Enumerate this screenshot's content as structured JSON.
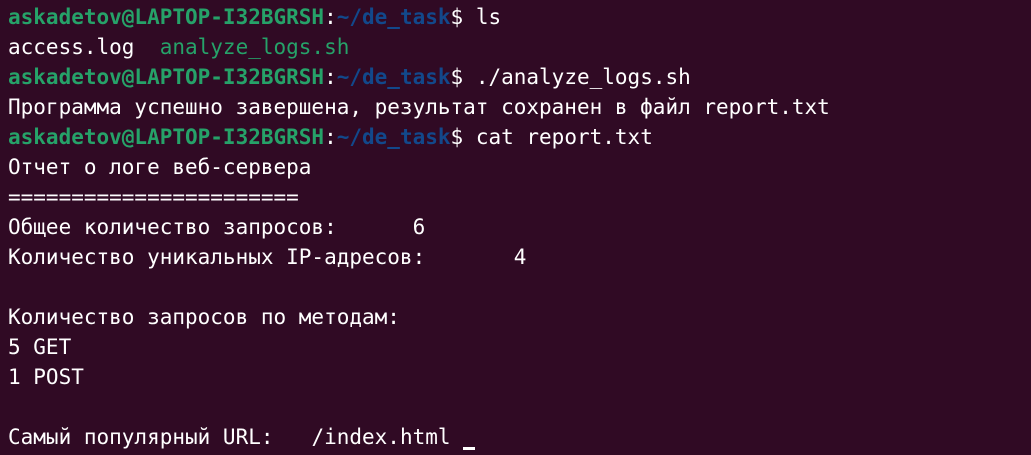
{
  "prompt": {
    "user_host": "askadetov@LAPTOP-I32BGRSH",
    "sep": ":",
    "path": "~/de_task",
    "symbol": "$ "
  },
  "commands": {
    "ls": "ls",
    "run": "./analyze_logs.sh",
    "cat": "cat report.txt"
  },
  "ls_output": {
    "file1": "access.log  ",
    "file2": "analyze_logs.sh"
  },
  "run_output": "Программа успешно завершена, результат сохранен в файл report.txt",
  "report": {
    "title": "Отчет о логе веб-сервера",
    "separator": "=======================",
    "total_label": "Общее количество запросов:",
    "total_gap": "      ",
    "total_value": "6",
    "unique_label": "Количество уникальных IP-адресов:",
    "unique_gap": "       ",
    "unique_value": "4",
    "methods_header": "Количество запросов по методам:",
    "methods": [
      "5 GET",
      "1 POST"
    ],
    "url_label": "Самый популярный URL:",
    "url_gap": "   ",
    "url_value": "/index.html"
  },
  "colors": {
    "background": "#300a24",
    "user_host": "#26a269",
    "path": "#12488b",
    "text": "#ffffff"
  }
}
